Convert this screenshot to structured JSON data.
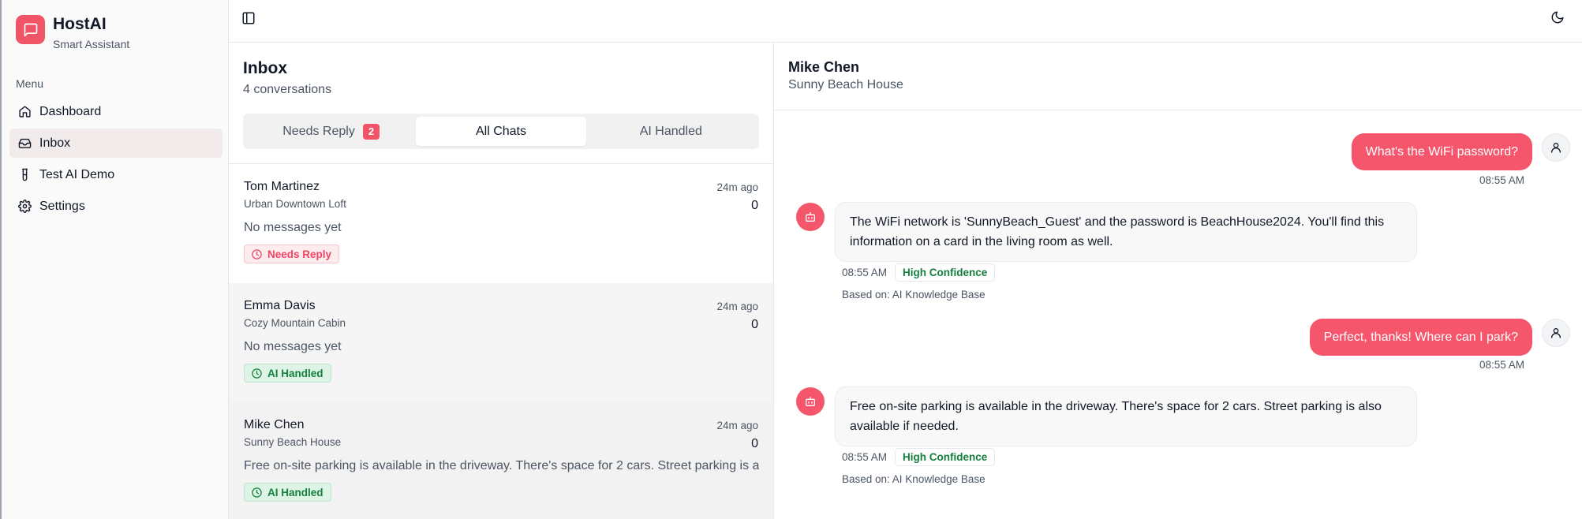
{
  "app": {
    "name": "HostAI",
    "subtitle": "Smart Assistant"
  },
  "sidebar": {
    "menu_label": "Menu",
    "items": [
      {
        "label": "Dashboard",
        "icon": "home-icon"
      },
      {
        "label": "Inbox",
        "icon": "inbox-icon",
        "active": true
      },
      {
        "label": "Test AI Demo",
        "icon": "test-tube-icon"
      },
      {
        "label": "Settings",
        "icon": "gear-icon"
      }
    ]
  },
  "inbox": {
    "title": "Inbox",
    "count_text": "4 conversations",
    "tabs": {
      "needs_reply": "Needs Reply",
      "needs_reply_count": "2",
      "all_chats": "All Chats",
      "ai_handled": "AI Handled"
    },
    "conversations": [
      {
        "name": "Tom Martinez",
        "property": "Urban Downtown Loft",
        "time": "24m ago",
        "unread": "0",
        "preview": "No messages yet",
        "status": "Needs Reply"
      },
      {
        "name": "Emma Davis",
        "property": "Cozy Mountain Cabin",
        "time": "24m ago",
        "unread": "0",
        "preview": "No messages yet",
        "status": "AI Handled"
      },
      {
        "name": "Mike Chen",
        "property": "Sunny Beach House",
        "time": "24m ago",
        "unread": "0",
        "preview": "Free on-site parking is available in the driveway. There's space for 2 cars. Street parking is also available if needed.",
        "status": "AI Handled"
      }
    ]
  },
  "chat": {
    "guest_name": "Mike Chen",
    "property": "Sunny Beach House",
    "messages": [
      {
        "from": "guest",
        "text": "What's the WiFi password?",
        "time": "08:55 AM"
      },
      {
        "from": "ai",
        "text": "The WiFi network is 'SunnyBeach_Guest' and the password is BeachHouse2024. You'll find this information on a card in the living room as well.",
        "time": "08:55 AM",
        "confidence": "High Confidence",
        "source": "Based on: AI Knowledge Base"
      },
      {
        "from": "guest",
        "text": "Perfect, thanks! Where can I park?",
        "time": "08:55 AM"
      },
      {
        "from": "ai",
        "text": "Free on-site parking is available in the driveway. There's space for 2 cars. Street parking is also available if needed.",
        "time": "08:55 AM",
        "confidence": "High Confidence",
        "source": "Based on: AI Knowledge Base"
      }
    ]
  },
  "colors": {
    "brand": "#f05467",
    "success": "#15803d"
  }
}
